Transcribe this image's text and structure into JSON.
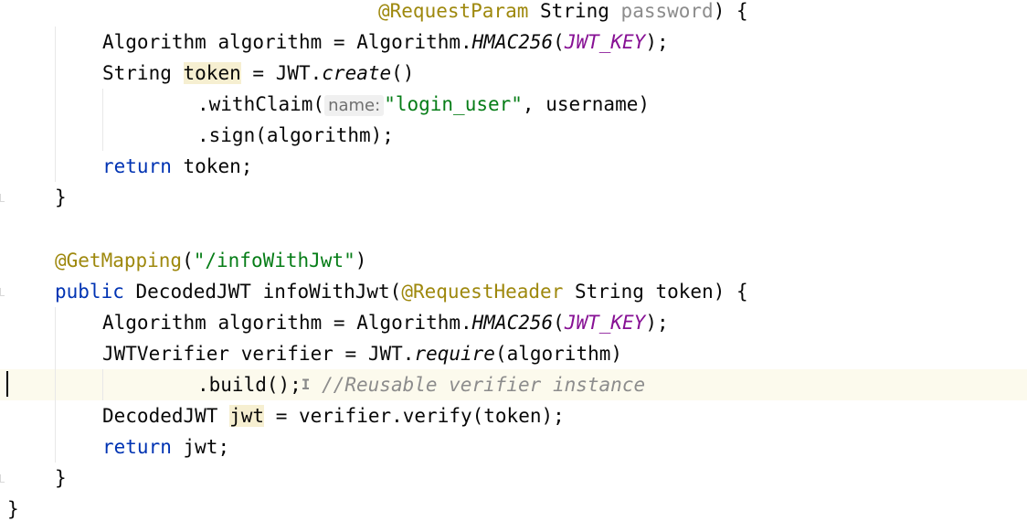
{
  "colors": {
    "background": "#ffffff",
    "keyword": "#0033b3",
    "annotation": "#9e880d",
    "string": "#067d17",
    "constant": "#871094",
    "comment": "#8c8c8c",
    "highlight": "#f6efd1",
    "current_line": "#fcfaed"
  },
  "lines": {
    "l1": {
      "annotation": "@RequestParam",
      "type": "String",
      "param": "password",
      "end": ") {"
    },
    "l2": {
      "type": "Algorithm",
      "var": "algorithm",
      "eq": "=",
      "cls": "Algorithm.",
      "method": "HMAC256",
      "open": "(",
      "const": "JWT_KEY",
      "close": ");"
    },
    "l3": {
      "type": "String",
      "var": "token",
      "eq": "=",
      "cls": "JWT.",
      "method": "create",
      "end": "()"
    },
    "l4": {
      "call": ".withClaim(",
      "hint": "name:",
      "string": "\"login_user\"",
      "rest": ", username)"
    },
    "l5": {
      "call": ".sign(algorithm);"
    },
    "l6": {
      "keyword": "return",
      "rest": "token;"
    },
    "l7": {
      "brace": "}"
    },
    "l8": {
      "annotation": "@GetMapping",
      "open": "(",
      "string": "\"/infoWithJwt\"",
      "close": ")"
    },
    "l9": {
      "keyword": "public",
      "type": "DecodedJWT",
      "method": "infoWithJwt(",
      "annotation": "@RequestHeader",
      "rest": "String token) {"
    },
    "l10": {
      "type": "Algorithm",
      "var": "algorithm",
      "eq": "=",
      "cls": "Algorithm.",
      "method": "HMAC256",
      "open": "(",
      "const": "JWT_KEY",
      "close": ");"
    },
    "l11": {
      "type": "JWTVerifier",
      "var": "verifier",
      "eq": "=",
      "cls": "JWT.",
      "method": "require",
      "rest": "(algorithm)"
    },
    "l12": {
      "call": ".build();",
      "ibeam": "I",
      "comment": "//Reusable verifier instance"
    },
    "l13": {
      "type": "DecodedJWT",
      "var": "jwt",
      "rest": "= verifier.verify(token);"
    },
    "l14": {
      "keyword": "return",
      "rest": "jwt;"
    },
    "l15": {
      "brace": "}"
    },
    "l16": {
      "brace": "}"
    }
  }
}
